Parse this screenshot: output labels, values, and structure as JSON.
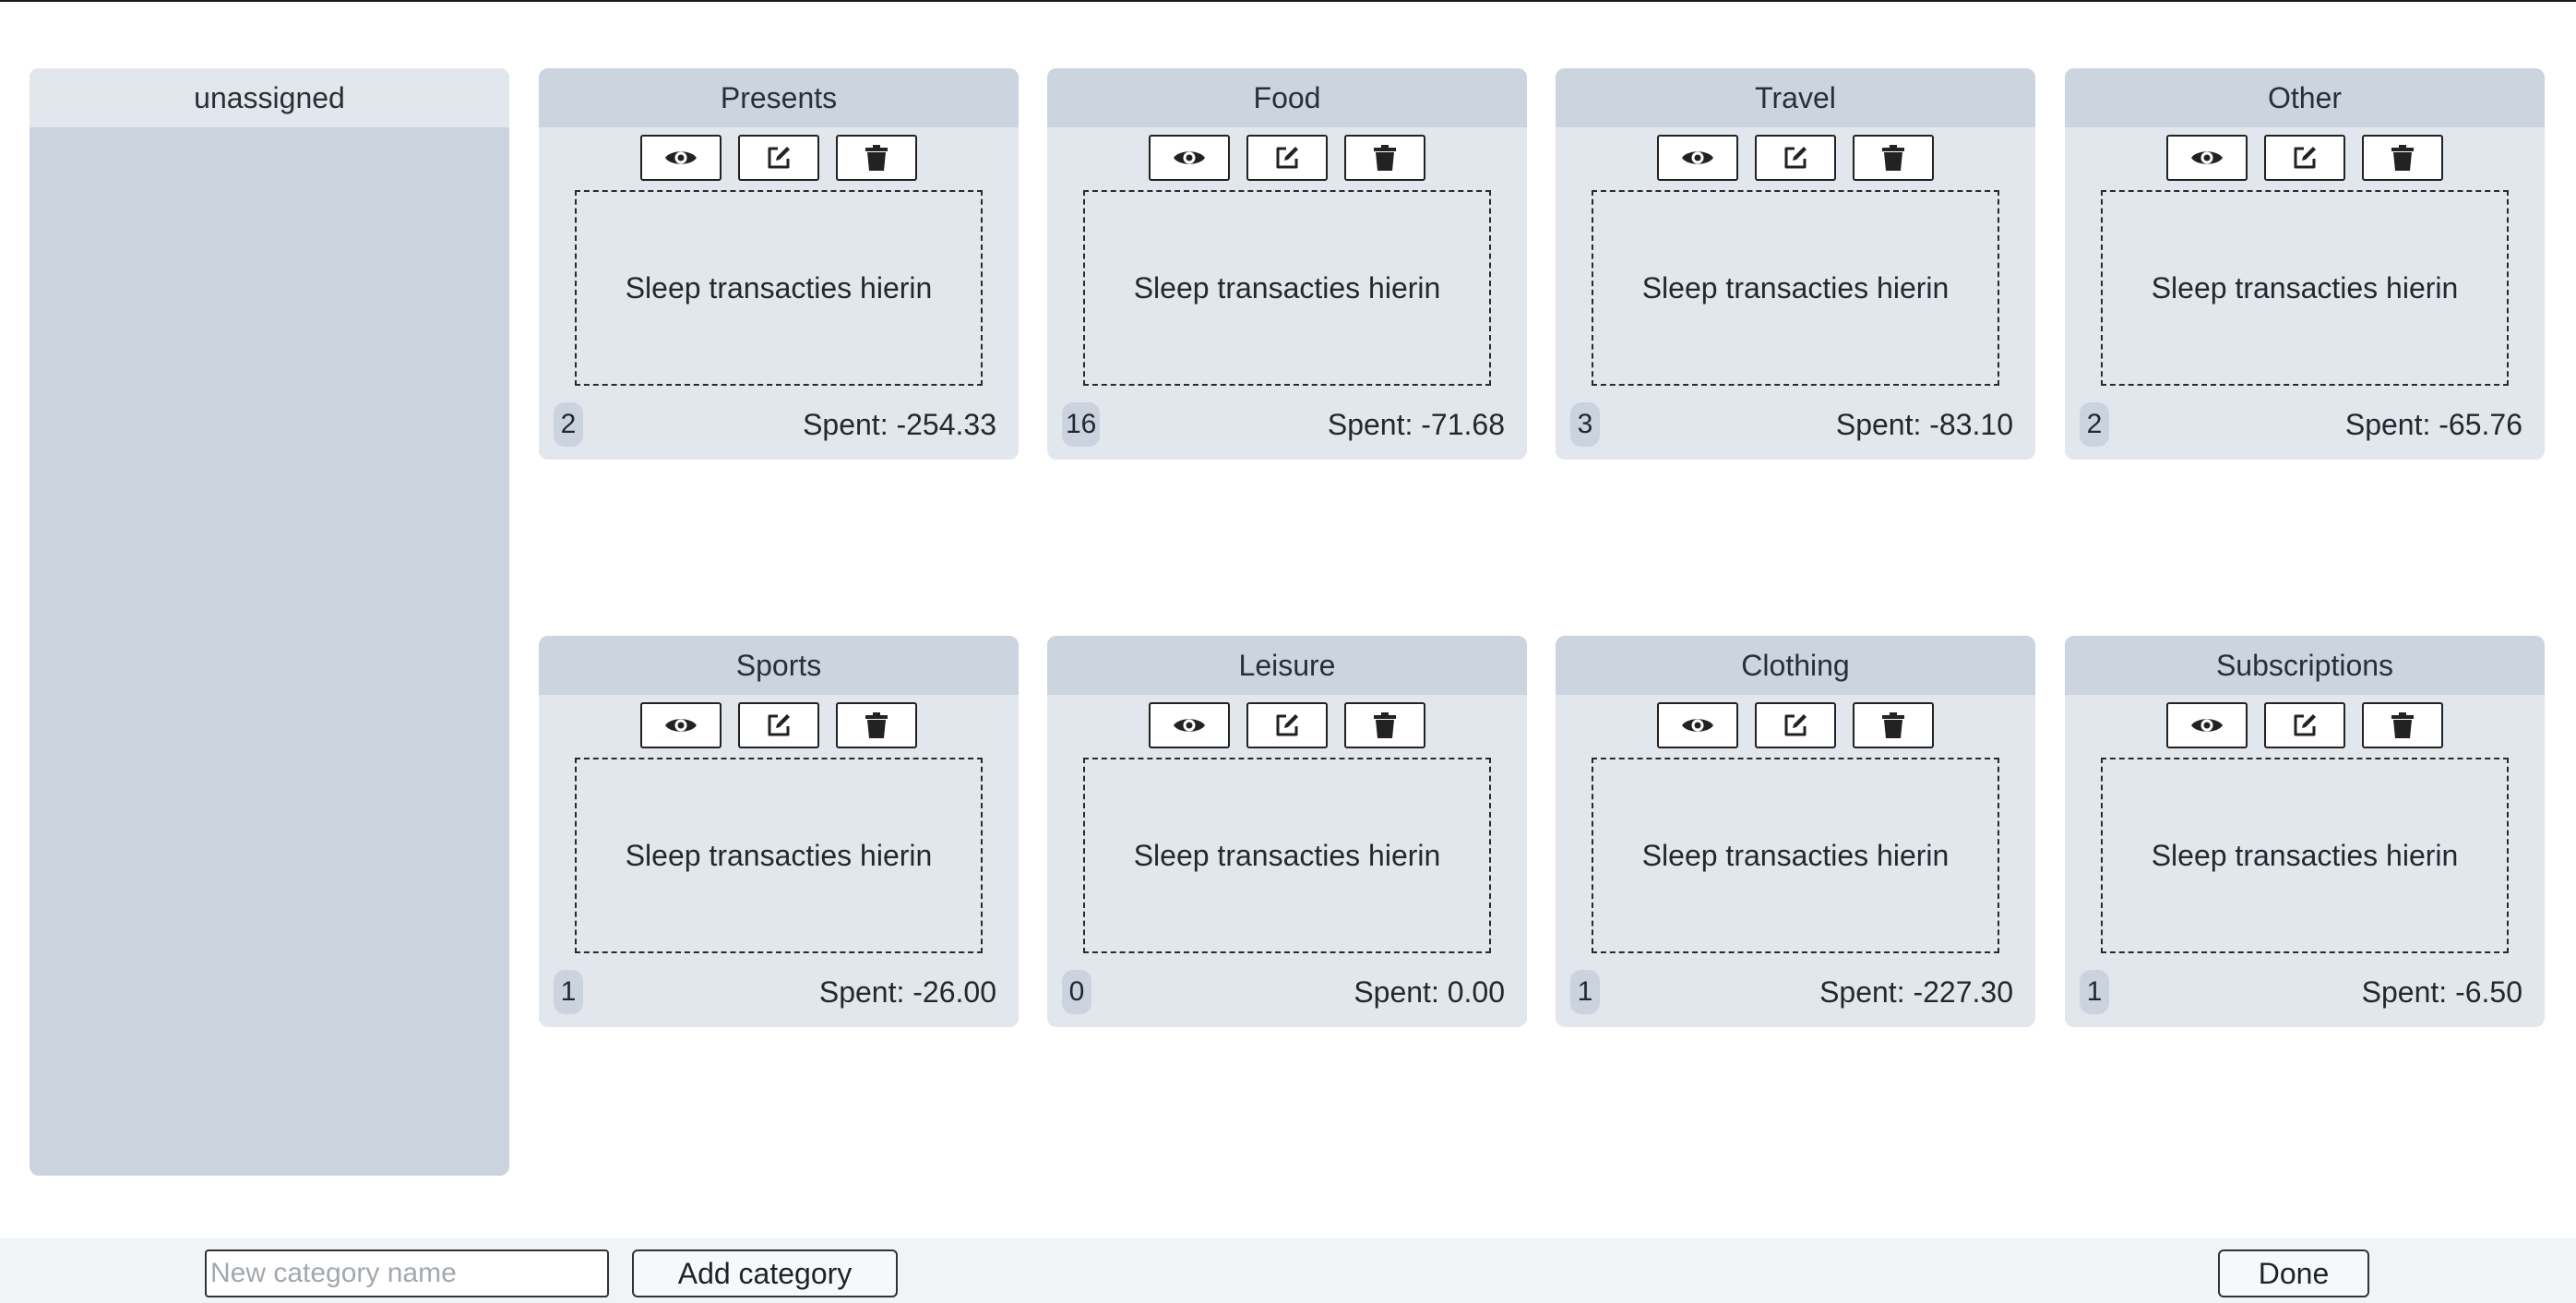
{
  "unassigned": {
    "title": "unassigned"
  },
  "dropzone_text": "Sleep transacties hierin",
  "categories": [
    {
      "name": "Presents",
      "count": "2",
      "spent": "Spent: -254.33"
    },
    {
      "name": "Food",
      "count": "16",
      "spent": "Spent: -71.68"
    },
    {
      "name": "Travel",
      "count": "3",
      "spent": "Spent: -83.10"
    },
    {
      "name": "Other",
      "count": "2",
      "spent": "Spent: -65.76"
    },
    {
      "name": "Sports",
      "count": "1",
      "spent": "Spent: -26.00"
    },
    {
      "name": "Leisure",
      "count": "0",
      "spent": "Spent: 0.00"
    },
    {
      "name": "Clothing",
      "count": "1",
      "spent": "Spent: -227.30"
    },
    {
      "name": "Subscriptions",
      "count": "1",
      "spent": "Spent: -6.50"
    }
  ],
  "icons": {
    "view": "eye-icon",
    "edit": "edit-icon",
    "delete": "trash-icon"
  },
  "footer": {
    "input_value": "",
    "input_placeholder": "New category name",
    "add_label": "Add category",
    "done_label": "Done"
  },
  "colors": {
    "card_bg": "#e2e7ee",
    "card_header": "#ccd4df",
    "unassigned_bg": "#cbd3de",
    "footer_bg": "#f1f4f7"
  }
}
